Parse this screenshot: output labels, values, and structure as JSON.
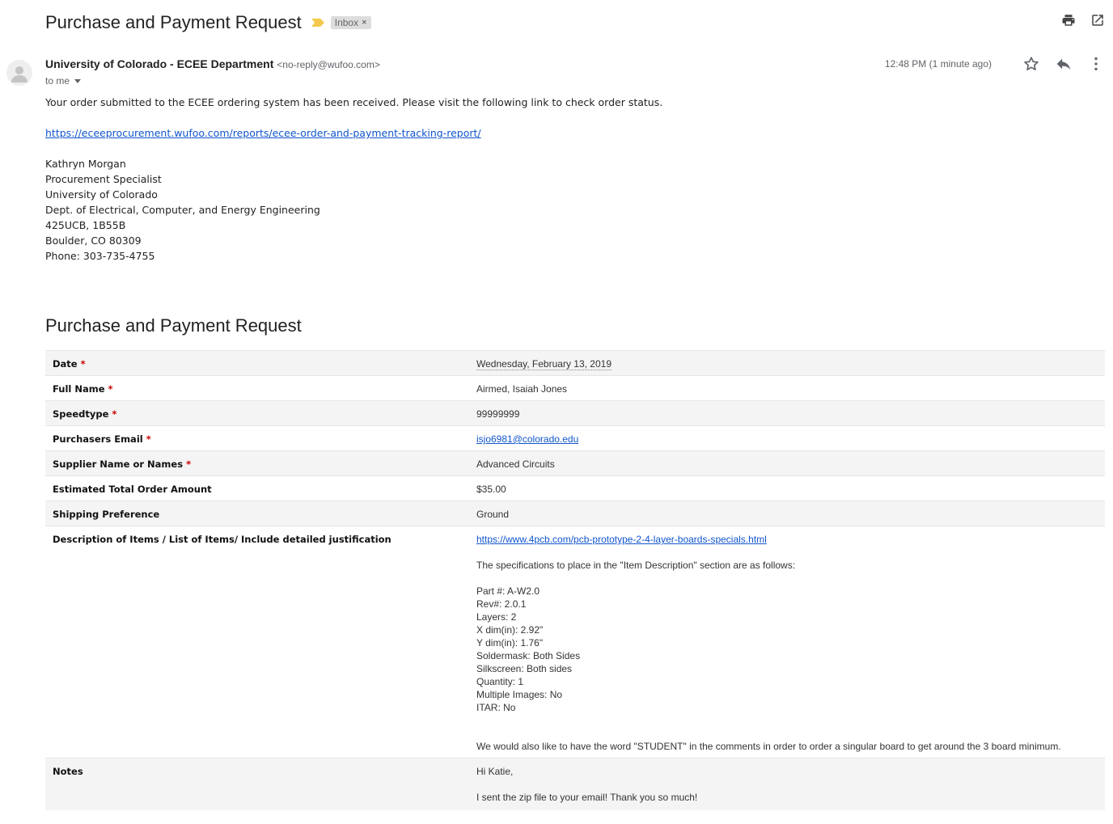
{
  "email": {
    "subject": "Purchase and Payment Request",
    "label_chip": "Inbox",
    "label_remove": "×",
    "sender_name": "University of Colorado - ECEE Department",
    "sender_email": "<no-reply@wufoo.com>",
    "recipient": "to me",
    "timestamp": "12:48 PM (1 minute ago)",
    "icons": {
      "print": "print-icon",
      "open_new": "open-in-new-window-icon",
      "star": "star-icon",
      "reply": "reply-icon",
      "more": "more-vertical-icon",
      "important": "importance-marker-icon",
      "avatar": "default-avatar-icon"
    },
    "colors": {
      "link": "#1155cc",
      "required": "#cc0000",
      "important_marker": "#f2c94c",
      "row_alt": "#f4f4f4"
    }
  },
  "body": {
    "intro": "Your order submitted to the ECEE ordering system has been received. Please visit the following link to check order status.",
    "tracking_link": "https://eceeprocurement.wufoo.com/reports/ecee-order-and-payment-tracking-report/",
    "signature": [
      "Kathryn Morgan",
      "Procurement Specialist",
      "University of Colorado",
      "Dept. of Electrical, Computer, and Energy Engineering",
      "425UCB, 1B55B",
      "Boulder, CO 80309",
      "Phone: 303-735-4755"
    ]
  },
  "form": {
    "title": "Purchase and Payment Request",
    "required_marker": "*",
    "rows": [
      {
        "label": "Date",
        "value": "Wednesday, February 13, 2019"
      },
      {
        "label": "Full Name",
        "value": "Airmed, Isaiah Jones"
      },
      {
        "label": "Speedtype",
        "value": "99999999"
      },
      {
        "label": "Purchasers Email",
        "value": "isjo6981@colorado.edu"
      },
      {
        "label": "Supplier Name or Names",
        "value": "Advanced Circuits"
      },
      {
        "label": "Estimated Total Order Amount",
        "value": "$35.00"
      },
      {
        "label": "Shipping Preference",
        "value": "Ground"
      },
      {
        "label": "Description of Items / List of Items/ Include detailed justification",
        "link": "https://www.4pcb.com/pcb-prototype-2-4-layer-boards-specials.html",
        "intro": "The specifications to place in the \"Item Description\" section are as follows:",
        "specs": [
          "Part #: A-W2.0",
          "Rev#: 2.0.1",
          "Layers: 2",
          "X dim(in): 2.92\"",
          "Y dim(in): 1.76\"",
          "Soldermask: Both Sides",
          "Silkscreen: Both sides",
          "Quantity: 1",
          "Multiple Images: No",
          "ITAR: No"
        ],
        "closing": "We would also like to have the word \"STUDENT\" in the comments in order to order a singular board to get around the 3 board minimum."
      },
      {
        "label": "Notes",
        "greeting": "Hi Katie,",
        "message": "I sent the zip file to your email! Thank you so much!"
      }
    ]
  }
}
